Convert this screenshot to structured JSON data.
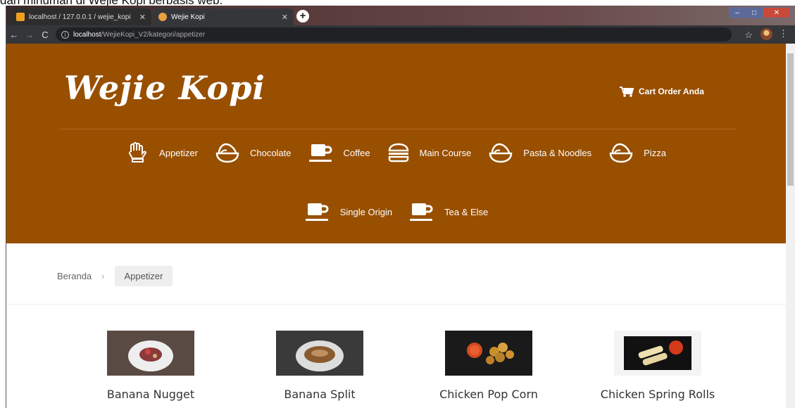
{
  "caption": "dan minuman di Wejie Kopi berbasis web.",
  "browser": {
    "tabs": [
      {
        "title": "localhost / 127.0.0.1 / wejie_kopi",
        "active": false
      },
      {
        "title": "Wejie Kopi",
        "active": true
      }
    ],
    "url_host": "localhost",
    "url_path": "/WejieKopi_V2/kategori/appetizer"
  },
  "site": {
    "logo": "Wejie Kopi",
    "cart_label": "Cart Order Anda",
    "colors": {
      "header": "#984f00"
    },
    "menu_row1": [
      {
        "label": "Appetizer",
        "icon": "hand-icon"
      },
      {
        "label": "Chocolate",
        "icon": "bowl-icon"
      },
      {
        "label": "Coffee",
        "icon": "cup-icon"
      },
      {
        "label": "Main Course",
        "icon": "burger-icon"
      },
      {
        "label": "Pasta & Noodles",
        "icon": "bowl-icon"
      },
      {
        "label": "Pizza",
        "icon": "bowl-icon"
      }
    ],
    "menu_row2": [
      {
        "label": "Single Origin",
        "icon": "cup-icon"
      },
      {
        "label": "Tea & Else",
        "icon": "cup-icon"
      }
    ],
    "breadcrumb": {
      "home": "Beranda",
      "current": "Appetizer"
    },
    "products": [
      {
        "name": "Banana Nugget"
      },
      {
        "name": "Banana Split"
      },
      {
        "name": "Chicken Pop Corn"
      },
      {
        "name": "Chicken Spring Rolls"
      }
    ]
  }
}
